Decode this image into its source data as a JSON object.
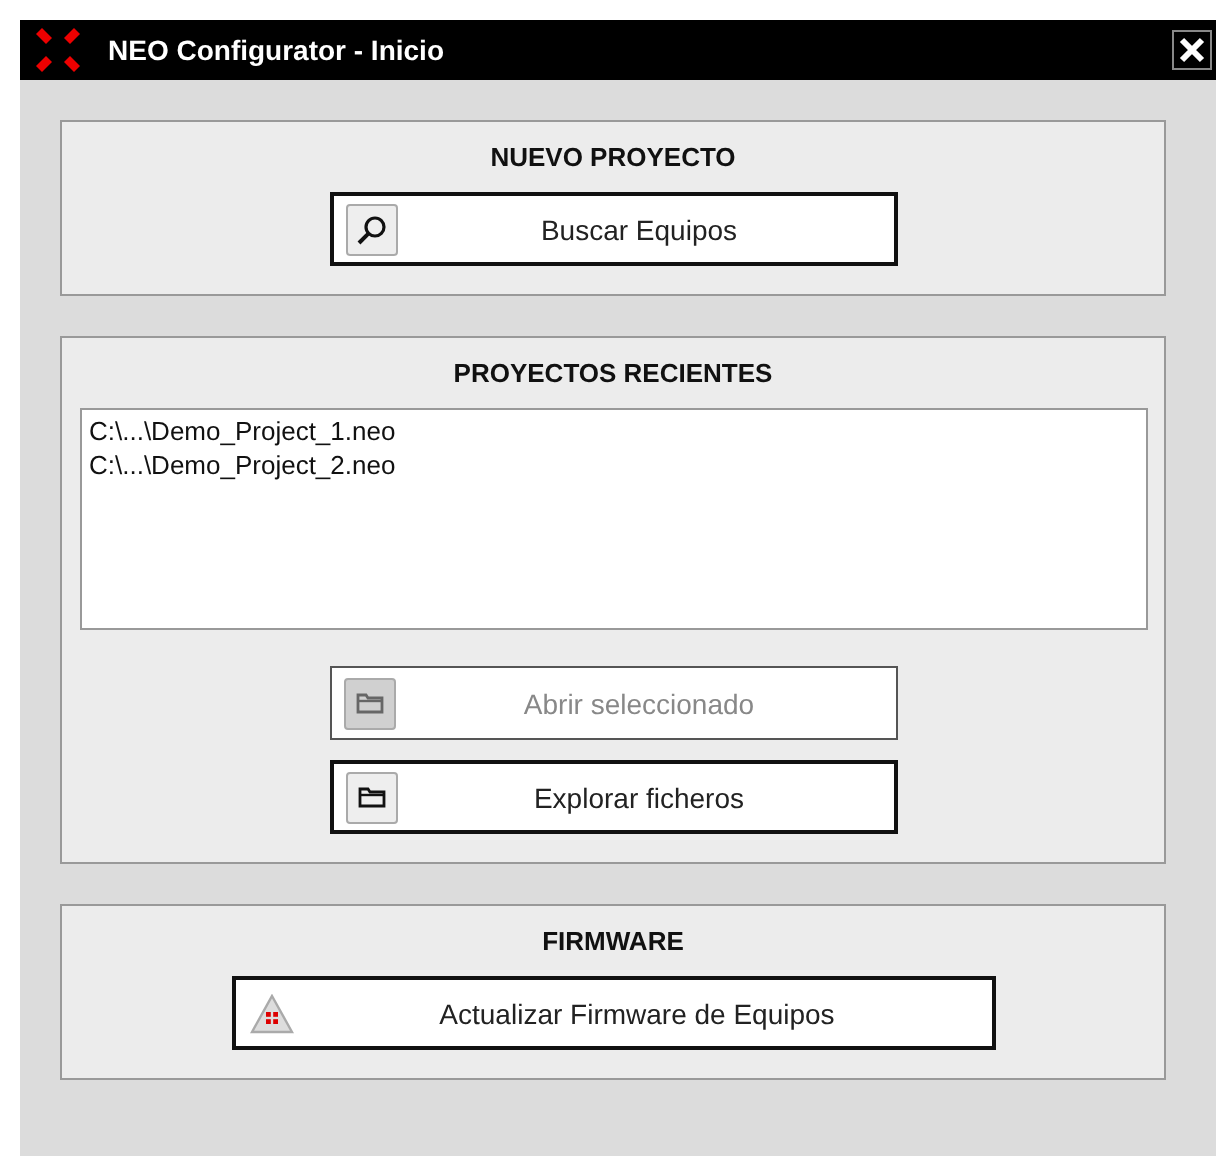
{
  "window": {
    "title": "NEO Configurator - Inicio"
  },
  "sections": [
    {
      "title": "NUEVO PROYECTO",
      "buttons": [
        {
          "label": "Buscar Equipos",
          "kind": "search",
          "disabled": false
        }
      ]
    },
    {
      "title": "PROYECTOS RECIENTES",
      "recent": [
        "C:\\...\\Demo_Project_1.neo",
        "C:\\...\\Demo_Project_2.neo"
      ],
      "buttons": [
        {
          "label": "Abrir seleccionado",
          "kind": "folder",
          "disabled": true
        },
        {
          "label": "Explorar ficheros",
          "kind": "folder",
          "disabled": false
        }
      ]
    },
    {
      "title": "FIRMWARE",
      "buttons": [
        {
          "label": "Actualizar Firmware de Equipos",
          "kind": "firmware",
          "disabled": false
        }
      ]
    }
  ]
}
